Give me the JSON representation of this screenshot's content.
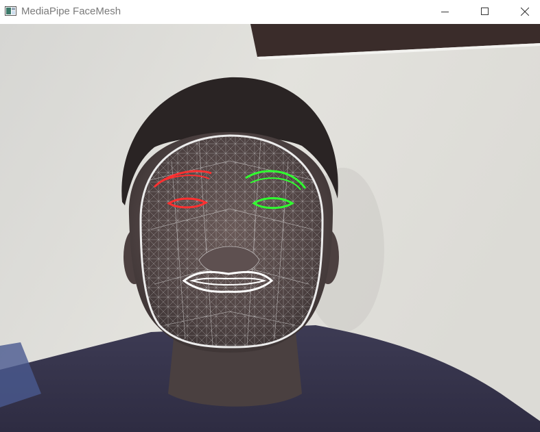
{
  "window": {
    "title": "MediaPipe FaceMesh",
    "icon": "opencv-window-icon"
  },
  "controls": {
    "minimize": "minimize-icon",
    "maximize": "maximize-icon",
    "close": "close-icon"
  },
  "overlay": {
    "mesh_color": "#e6e6e6",
    "face_oval_color": "#e8e8e8",
    "lips_color": "#ffffff",
    "right_eye_color": "#ff3030",
    "left_eye_color": "#30ff30"
  }
}
